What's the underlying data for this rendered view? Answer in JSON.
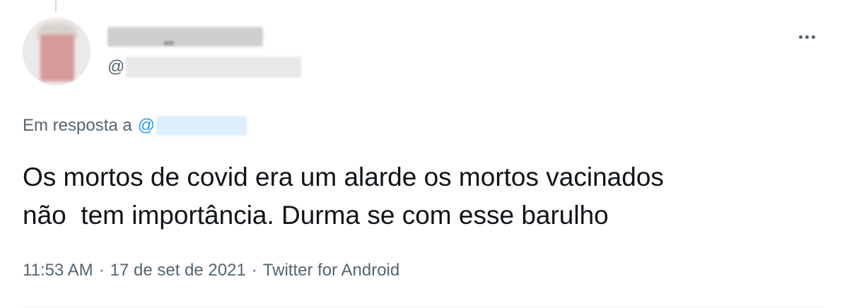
{
  "tweet": {
    "author": {
      "handle_prefix": "@"
    },
    "reply": {
      "prefix": "Em resposta a",
      "mention_prefix": "@"
    },
    "text": "Os mortos de covid era um alarde os mortos vacinados\nnão  tem importância. Durma se com esse barulho",
    "meta": {
      "time": "11:53 AM",
      "separator": "·",
      "date": "17 de set de 2021",
      "source": "Twitter for Android"
    }
  },
  "colors": {
    "text_primary": "#0f1419",
    "text_secondary": "#536471",
    "accent": "#1d9bf0"
  },
  "icons": {
    "more": "more-horizontal-icon"
  }
}
